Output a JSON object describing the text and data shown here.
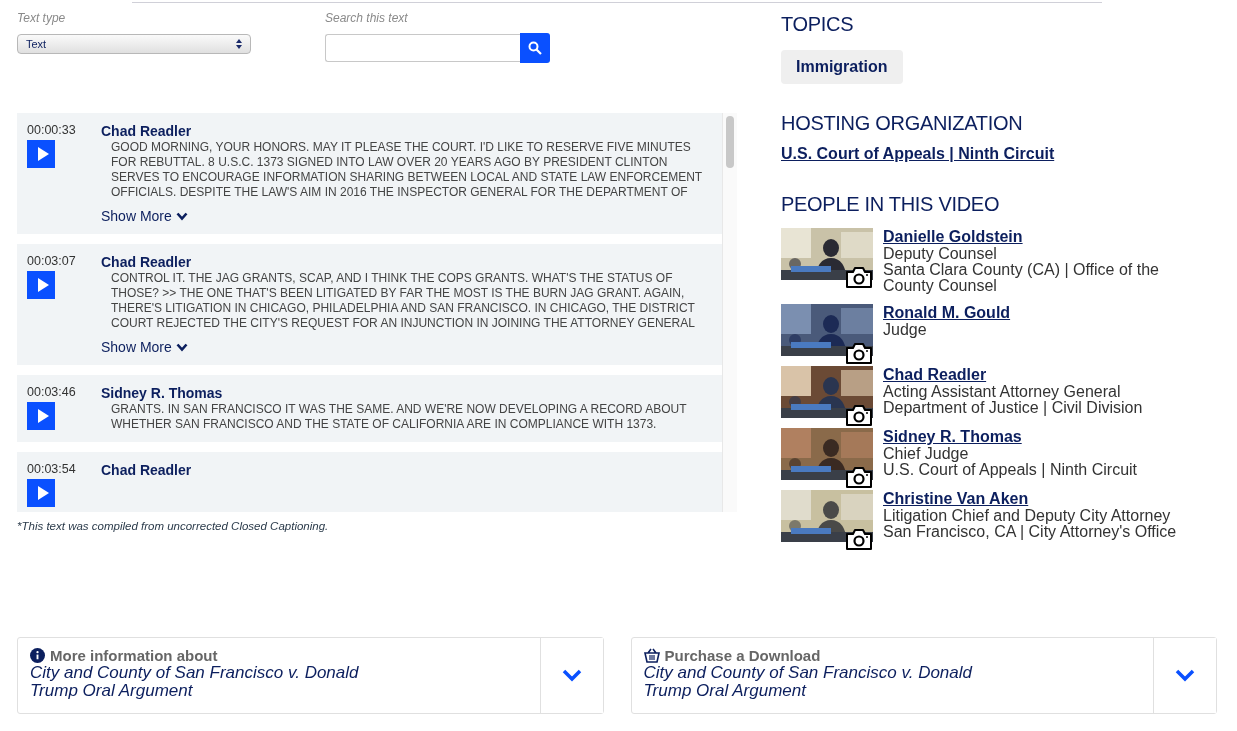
{
  "text_type": {
    "label": "Text type",
    "value": "Text"
  },
  "search": {
    "label": "Search this text"
  },
  "transcript": [
    {
      "time": "00:00:33",
      "speaker": "Chad Readler",
      "text": "GOOD MORNING, YOUR HONORS. MAY IT PLEASE THE COURT. I'D LIKE TO RESERVE FIVE MINUTES FOR REBUTTAL. 8 U.S.C. 1373 SIGNED INTO LAW OVER 20 YEARS AGO BY PRESIDENT CLINTON SERVES TO ENCOURAGE INFORMATION SHARING BETWEEN LOCAL AND STATE LAW ENFORCEMENT OFFICIALS. DESPITE THE LAW'S AIM IN 2016 THE INSPECTOR GENERAL FOR THE DEPARTMENT OF",
      "more": "Show More"
    },
    {
      "time": "00:03:07",
      "speaker": "Chad Readler",
      "text": "CONTROL IT. THE JAG GRANTS, SCAP, AND I THINK THE COPS GRANTS. WHAT'S THE STATUS OF THOSE? >> THE ONE THAT'S BEEN LITIGATED BY FAR THE MOST IS THE BURN JAG GRANT. AGAIN, THERE'S LITIGATION IN CHICAGO, PHILADELPHIA AND SAN FRANCISCO. IN CHICAGO, THE DISTRICT COURT REJECTED THE CITY'S REQUEST FOR AN INJUNCTION IN JOINING THE ATTORNEY GENERAL",
      "more": "Show More"
    },
    {
      "time": "00:03:46",
      "speaker": "Sidney R. Thomas",
      "text": "GRANTS. IN SAN FRANCISCO IT WAS THE SAME. AND WE'RE NOW DEVELOPING A RECORD ABOUT WHETHER SAN FRANCISCO AND THE STATE OF CALIFORNIA ARE IN COMPLIANCE WITH 1373."
    },
    {
      "time": "00:03:54",
      "speaker": "Chad Readler"
    }
  ],
  "caption_note": "*This text was compiled from uncorrected Closed Captioning.",
  "topics": {
    "heading": "TOPICS",
    "items": [
      "Immigration"
    ]
  },
  "hosting": {
    "heading": "HOSTING ORGANIZATION",
    "name": "U.S. Court of Appeals | Ninth Circuit"
  },
  "people": {
    "heading": "PEOPLE IN THIS VIDEO",
    "items": [
      {
        "name": "Danielle Goldstein",
        "lines": [
          "Deputy Counsel",
          "Santa Clara County (CA) | Office of the County Counsel"
        ]
      },
      {
        "name": "Ronald M. Gould",
        "lines": [
          "Judge"
        ]
      },
      {
        "name": "Chad Readler",
        "lines": [
          "Acting Assistant Attorney General",
          "Department of Justice | Civil Division"
        ]
      },
      {
        "name": "Sidney R. Thomas",
        "lines": [
          "Chief Judge",
          "U.S. Court of Appeals | Ninth Circuit"
        ]
      },
      {
        "name": "Christine Van Aken",
        "lines": [
          "Litigation Chief and Deputy City Attorney",
          "San Francisco, CA | City Attorney's Office"
        ]
      }
    ]
  },
  "panels": [
    {
      "kind": "info",
      "label": "More information about",
      "title": "City and County of San Francisco v. Donald Trump Oral Argument"
    },
    {
      "kind": "purchase",
      "label": "Purchase a Download",
      "title": "City and County of San Francisco v. Donald Trump Oral Argument"
    }
  ]
}
